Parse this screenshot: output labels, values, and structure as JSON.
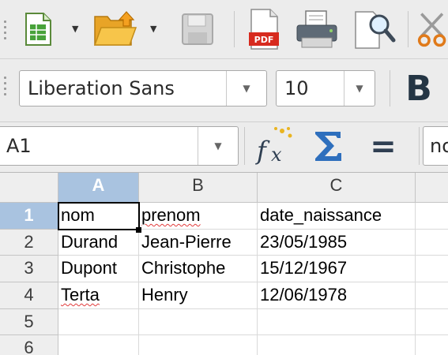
{
  "toolbar1": {
    "buttons": [
      {
        "name": "new-spreadsheet-button",
        "icon": "spreadsheet-icon"
      },
      {
        "name": "open-button",
        "icon": "folder-open-icon"
      },
      {
        "name": "save-button",
        "icon": "save-icon"
      },
      {
        "name": "export-pdf-button",
        "icon": "pdf-icon",
        "label": "PDF"
      },
      {
        "name": "print-button",
        "icon": "printer-icon"
      },
      {
        "name": "print-preview-button",
        "icon": "print-preview-icon"
      },
      {
        "name": "cut-button",
        "icon": "scissors-icon"
      }
    ]
  },
  "toolbar2": {
    "font_name": "Liberation Sans",
    "font_size": "10",
    "bold_label": "B"
  },
  "formula_bar": {
    "name_box": "A1",
    "function_wizard_icon": "fx-icon",
    "sum_icon": "sigma-icon",
    "equals_label": "=",
    "content": "nom"
  },
  "sheet": {
    "columns": [
      "A",
      "B",
      "C",
      ""
    ],
    "rows": [
      "1",
      "2",
      "3",
      "4",
      "5",
      "6"
    ],
    "selected_cell": "A1",
    "cells": [
      [
        "nom",
        "prenom",
        "date_naissance"
      ],
      [
        "Durand",
        "Jean-Pierre",
        "23/05/1985"
      ],
      [
        "Dupont",
        "Christophe",
        "15/12/1967"
      ],
      [
        "Terta",
        "Henry",
        "12/06/1978"
      ],
      [
        "",
        "",
        ""
      ],
      [
        "",
        "",
        ""
      ]
    ]
  },
  "colors": {
    "selected_header": "#a9c3e0",
    "spell_error": "#e23b3b"
  }
}
